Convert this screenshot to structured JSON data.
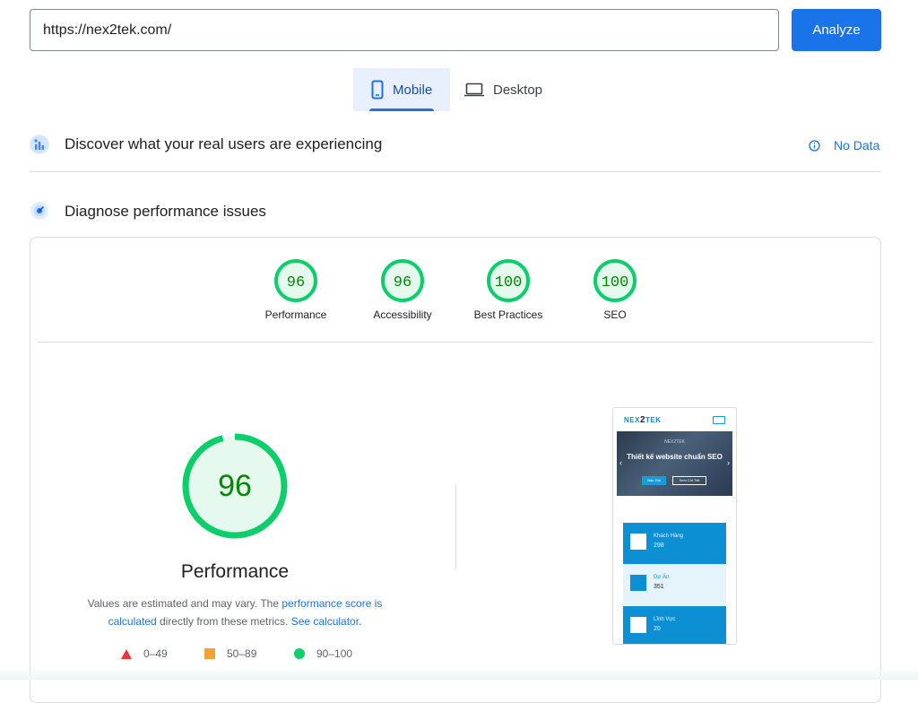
{
  "search": {
    "url_value": "https://nex2tek.com/",
    "analyze_label": "Analyze"
  },
  "tabs": [
    {
      "label": "Mobile",
      "active": true
    },
    {
      "label": "Desktop",
      "active": false
    }
  ],
  "field_data": {
    "title": "Discover what your real users are experiencing",
    "status": "No Data"
  },
  "lab": {
    "title": "Diagnose performance issues"
  },
  "scores": [
    {
      "value": "96",
      "label": "Performance"
    },
    {
      "value": "96",
      "label": "Accessibility"
    },
    {
      "value": "100",
      "label": "Best Practices"
    },
    {
      "value": "100",
      "label": "SEO"
    }
  ],
  "main_score": {
    "value": "96",
    "fraction": 0.96,
    "label": "Performance"
  },
  "description": {
    "part1": "Values are estimated and may vary. The ",
    "link1": "performance score is calculated",
    "part2": " directly from these metrics. ",
    "link2": "See calculator."
  },
  "legend": [
    {
      "range": "0–49",
      "shape": "triangle",
      "color": "#e53935"
    },
    {
      "range": "50–89",
      "shape": "square",
      "color": "#f4a03a"
    },
    {
      "range": "90–100",
      "shape": "circle",
      "color": "#0cce6b"
    }
  ],
  "colors": {
    "accent": "#1a73e8",
    "pass": "#0cce6b",
    "pass_text": "#008800",
    "pass_bg": "#e6f9ee"
  },
  "screenshot": {
    "logo_prefix": "NEX",
    "logo_mid": "2",
    "logo_suffix": "TEK",
    "hero_brand": "NEX2TEK",
    "hero_headline": "Thiết kế website chuẩn SEO",
    "btn_primary": "Báo Giá",
    "btn_secondary": "Xem Chi Tiết",
    "stats": [
      {
        "title": "Khách Hàng",
        "number": "298"
      },
      {
        "title": "Dự Án",
        "number": "351"
      },
      {
        "title": "Lĩnh Vực",
        "number": "20"
      }
    ]
  }
}
